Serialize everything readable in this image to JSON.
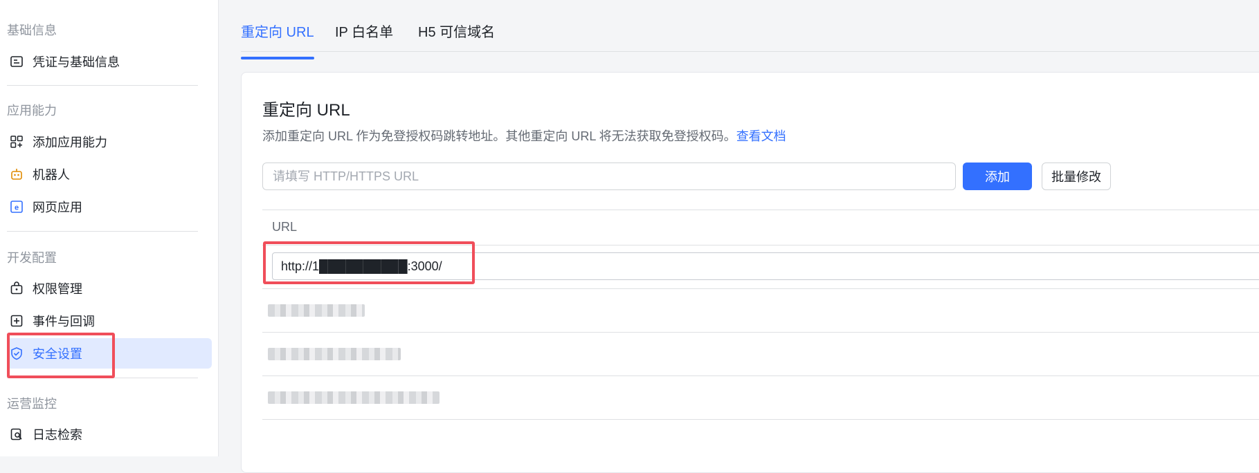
{
  "sidebar": {
    "groups": [
      {
        "title": "基础信息",
        "items": [
          {
            "label": "凭证与基础信息",
            "icon": "credential-icon"
          }
        ]
      },
      {
        "title": "应用能力",
        "items": [
          {
            "label": "添加应用能力",
            "icon": "grid-add-icon"
          },
          {
            "label": "机器人",
            "icon": "robot-icon"
          },
          {
            "label": "网页应用",
            "icon": "web-app-icon"
          }
        ]
      },
      {
        "title": "开发配置",
        "items": [
          {
            "label": "权限管理",
            "icon": "lock-bag-icon"
          },
          {
            "label": "事件与回调",
            "icon": "event-icon"
          },
          {
            "label": "安全设置",
            "icon": "shield-check-icon",
            "active": true
          }
        ]
      },
      {
        "title": "运营监控",
        "items": [
          {
            "label": "日志检索",
            "icon": "log-search-icon"
          }
        ]
      }
    ]
  },
  "tabs": [
    {
      "label": "重定向 URL",
      "active": true
    },
    {
      "label": "IP 白名单"
    },
    {
      "label": "H5 可信域名"
    }
  ],
  "card": {
    "title": "重定向 URL",
    "description": "添加重定向 URL 作为免登授权码跳转地址。其他重定向 URL 将无法获取免登授权码。",
    "doc_link": "查看文档",
    "input_placeholder": "请填写 HTTP/HTTPS URL",
    "add_button": "添加",
    "batch_button": "批量修改",
    "table": {
      "header": "URL",
      "editing_value": "http://1██████████:3000/"
    }
  },
  "colors": {
    "accent": "#3370ff",
    "highlight": "#f04e5a",
    "active_bg": "#e1eaff"
  }
}
